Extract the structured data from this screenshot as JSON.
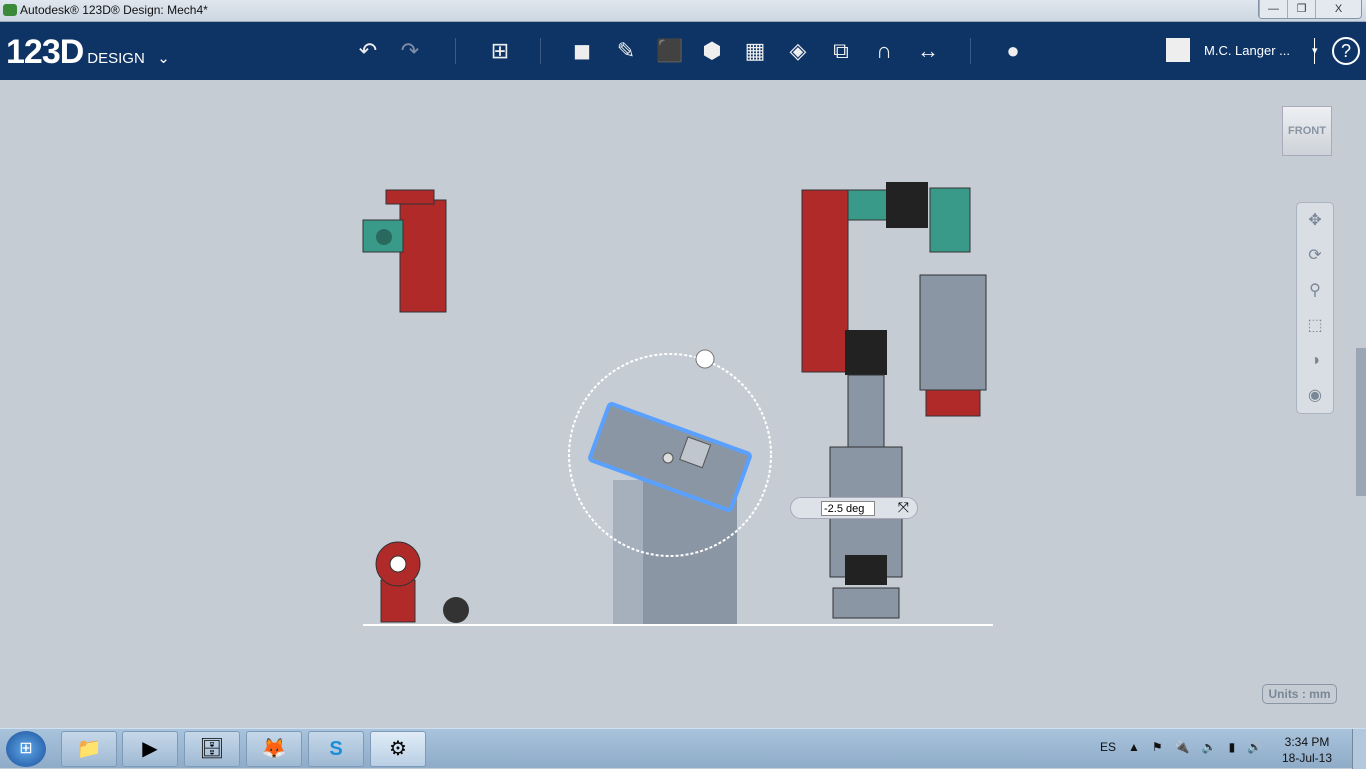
{
  "window": {
    "title": "Autodesk® 123D® Design: Mech4*",
    "minimize": "—",
    "restore": "❐",
    "close": "X"
  },
  "toolbar": {
    "logo": "123D",
    "logo_sub": "DESIGN",
    "logo_chevron": "⌄",
    "undo": "↶",
    "redo": "↷",
    "user": "M.C. Langer ...",
    "user_chevron": "▾",
    "help": "?"
  },
  "tools": [
    {
      "name": "transform-icon",
      "glyph": "⊞"
    },
    {
      "name": "primitives-icon",
      "glyph": "◼"
    },
    {
      "name": "sketch-icon",
      "glyph": "✎"
    },
    {
      "name": "construct-icon",
      "glyph": "⬛"
    },
    {
      "name": "modify-icon",
      "glyph": "⬢"
    },
    {
      "name": "pattern-icon",
      "glyph": "▦"
    },
    {
      "name": "grouping-icon",
      "glyph": "◈"
    },
    {
      "name": "combine-icon",
      "glyph": "⧉"
    },
    {
      "name": "snap-icon",
      "glyph": "∩"
    },
    {
      "name": "measure-icon",
      "glyph": "↔"
    },
    {
      "name": "material-icon",
      "glyph": "●"
    }
  ],
  "viewcube": "FRONT",
  "nav": [
    "✥",
    "⟳",
    "⚲",
    "⬚",
    "◑",
    "◉"
  ],
  "angle_input": "-2.5 deg",
  "units": "Units : mm",
  "taskbar": {
    "start": "⊞",
    "apps": [
      "📁",
      "▶",
      "🗄",
      "🦊",
      "S",
      "⚙"
    ],
    "lang": "ES",
    "tray": [
      "▲",
      "⚑",
      "🔌",
      "🔈",
      "▮",
      "🔊"
    ],
    "time": "3:34 PM",
    "date": "18-Jul-13"
  }
}
